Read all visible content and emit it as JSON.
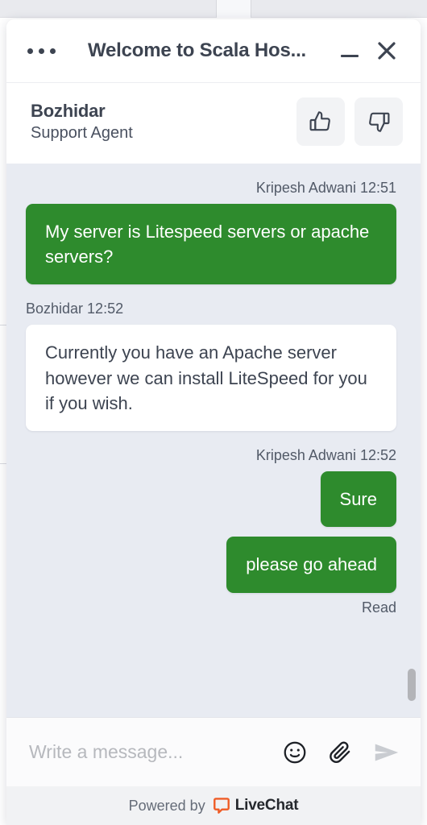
{
  "titlebar": {
    "menu_icon": "more-horizontal-icon",
    "title": "Welcome to Scala Hos...",
    "minimize_icon": "minimize-icon",
    "close_icon": "close-icon"
  },
  "agent": {
    "name": "Bozhidar",
    "role": "Support Agent",
    "thumbs_up_icon": "thumbs-up-icon",
    "thumbs_down_icon": "thumbs-down-icon"
  },
  "conversation": {
    "groups": [
      {
        "direction": "out",
        "meta": "Kripesh Adwani 12:51",
        "bubbles": [
          "My server is Litespeed servers or apache servers?"
        ],
        "status": ""
      },
      {
        "direction": "in",
        "meta": "Bozhidar 12:52",
        "bubbles": [
          "Currently you have an Apache server however we can install LiteSpeed for you if you wish."
        ],
        "status": ""
      },
      {
        "direction": "out",
        "meta": "Kripesh Adwani 12:52",
        "bubbles": [
          "Sure",
          "please go ahead"
        ],
        "status": "Read"
      }
    ]
  },
  "composer": {
    "placeholder": "Write a message...",
    "value": "",
    "emoji_icon": "emoji-icon",
    "attach_icon": "paperclip-icon",
    "send_icon": "send-icon"
  },
  "footer": {
    "powered_by": "Powered by",
    "brand": "LiveChat",
    "brand_icon": "livechat-logo-icon"
  },
  "colors": {
    "outgoing_bubble": "#2e8b2d",
    "incoming_bubble": "#ffffff",
    "message_list_bg": "#e8ebf2",
    "text_primary": "#3d4451",
    "brand_orange": "#ef5c26"
  }
}
